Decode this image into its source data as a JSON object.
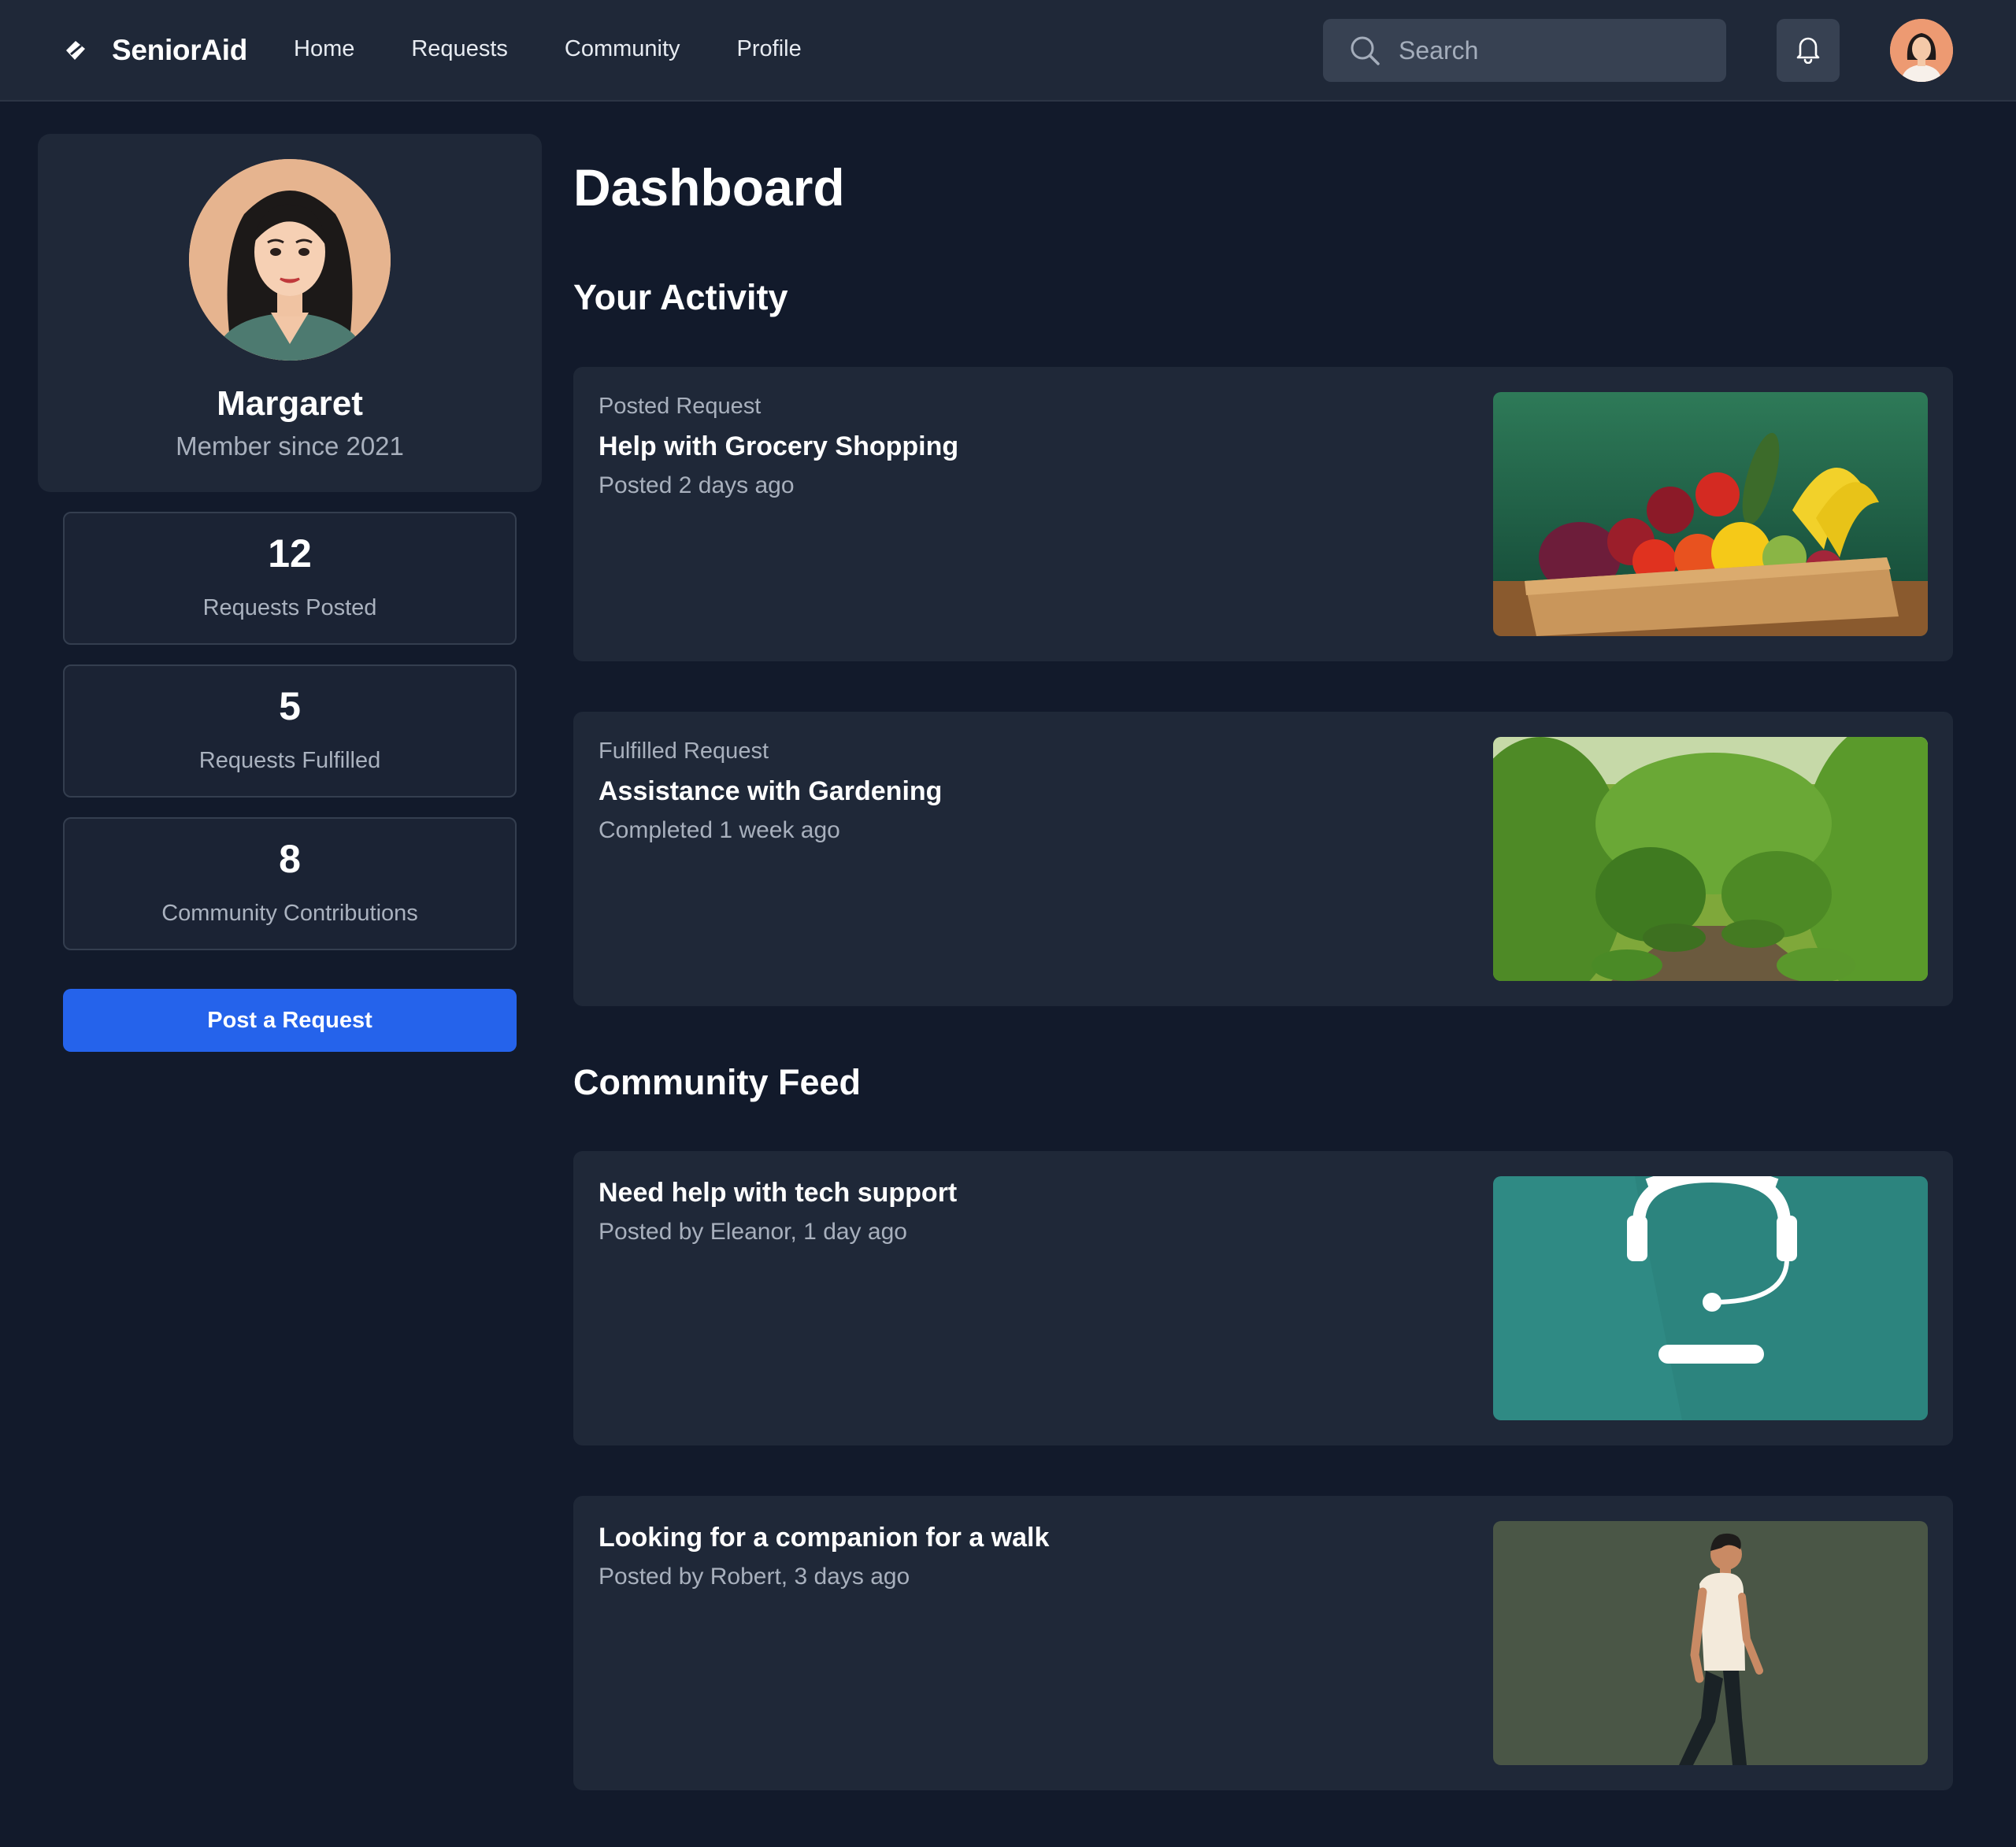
{
  "app": {
    "brand": "SeniorAid",
    "nav": [
      "Home",
      "Requests",
      "Community",
      "Profile"
    ],
    "search_placeholder": "Search",
    "icons": {
      "brand": "feather-icon",
      "search": "search-icon",
      "notifications": "bell-icon",
      "user": "avatar"
    }
  },
  "profile": {
    "name": "Margaret",
    "since": "Member since 2021"
  },
  "stats": [
    {
      "value": "12",
      "label": "Requests Posted"
    },
    {
      "value": "5",
      "label": "Requests Fulfilled"
    },
    {
      "value": "8",
      "label": "Community Contributions"
    }
  ],
  "post_request_label": "Post a Request",
  "page_title": "Dashboard",
  "activity": {
    "title": "Your Activity",
    "items": [
      {
        "kicker": "Posted Request",
        "title": "Help with Grocery Shopping",
        "meta": "Posted 2 days ago"
      },
      {
        "kicker": "Fulfilled Request",
        "title": "Assistance with Gardening",
        "meta": "Completed 1 week ago"
      }
    ]
  },
  "feed": {
    "title": "Community Feed",
    "items": [
      {
        "title": "Need help with tech support",
        "meta": "Posted by Eleanor, 1 day ago"
      },
      {
        "title": "Looking for a companion for a walk",
        "meta": "Posted by Robert, 3 days ago"
      }
    ]
  },
  "colors": {
    "background": "#121a2b",
    "surface": "#1f2838",
    "accent": "#2563eb",
    "muted_text": "#a8b0bd"
  }
}
